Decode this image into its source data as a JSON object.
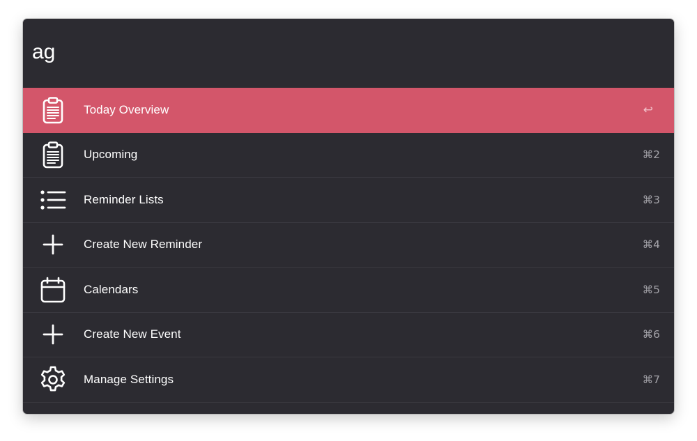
{
  "search": {
    "value": "ag",
    "placeholder": ""
  },
  "colors": {
    "window_bg": "#2c2b31",
    "selection": "#d3566a",
    "text": "#ffffff",
    "shortcut_text": "#a3a2a8",
    "divider": "#3a3940"
  },
  "commands": [
    {
      "label": "Today Overview",
      "shortcut": "↩",
      "icon": "clipboard-icon",
      "selected": true
    },
    {
      "label": "Upcoming",
      "shortcut": "⌘2",
      "icon": "clipboard-icon",
      "selected": false
    },
    {
      "label": "Reminder Lists",
      "shortcut": "⌘3",
      "icon": "list-icon",
      "selected": false
    },
    {
      "label": "Create New Reminder",
      "shortcut": "⌘4",
      "icon": "plus-icon",
      "selected": false
    },
    {
      "label": "Calendars",
      "shortcut": "⌘5",
      "icon": "calendar-icon",
      "selected": false
    },
    {
      "label": "Create New Event",
      "shortcut": "⌘6",
      "icon": "plus-icon",
      "selected": false
    },
    {
      "label": "Manage Settings",
      "shortcut": "⌘7",
      "icon": "gear-icon",
      "selected": false
    }
  ]
}
